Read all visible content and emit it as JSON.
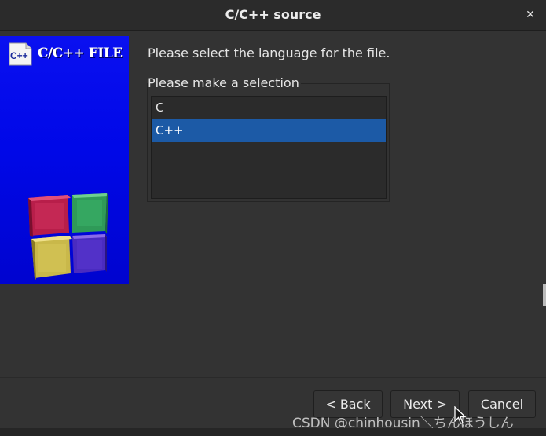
{
  "window": {
    "title": "C/C++ source",
    "close_glyph": "✕"
  },
  "banner": {
    "title": "C/C++ FILE",
    "icon_text": "C++",
    "icon": "cpp-file-icon",
    "graphic": "colored-cubes-graphic"
  },
  "main": {
    "prompt": "Please select the language for the file.",
    "group_label": "Please make a selection",
    "options": [
      {
        "label": "C",
        "selected": false
      },
      {
        "label": "C++",
        "selected": true
      }
    ]
  },
  "footer": {
    "back_label": "< Back",
    "next_label": "Next >",
    "cancel_label": "Cancel"
  },
  "watermark": "CSDN @chinhousin＼ちんほうしん",
  "colors": {
    "selection": "#1c5aa6",
    "banner_blue": "#0008e8",
    "background": "#333333"
  }
}
